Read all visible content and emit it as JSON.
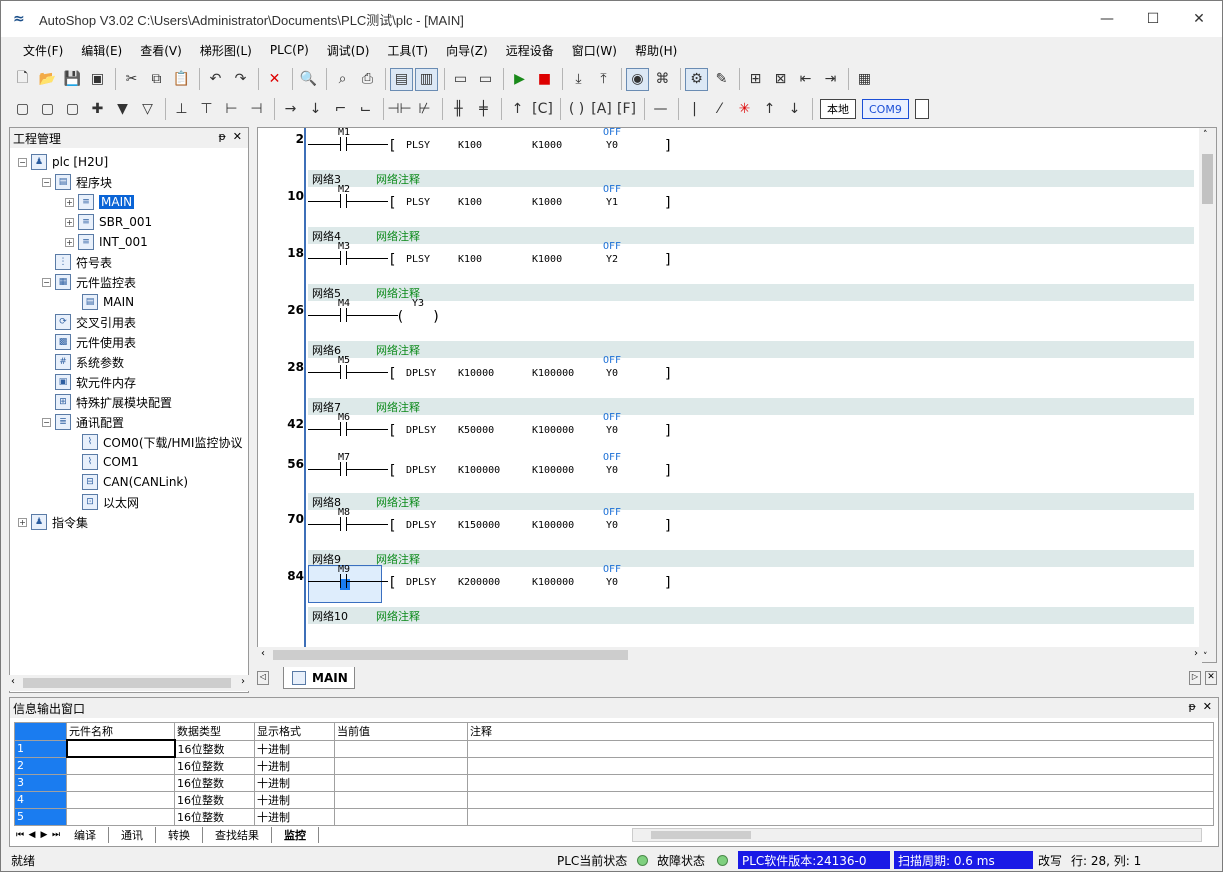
{
  "window": {
    "title": "AutoShop V3.02  C:\\Users\\Administrator\\Documents\\PLC测试\\plc - [MAIN]"
  },
  "menu": [
    "文件(F)",
    "编辑(E)",
    "查看(V)",
    "梯形图(L)",
    "PLC(P)",
    "调试(D)",
    "工具(T)",
    "向导(Z)",
    "远程设备",
    "窗口(W)",
    "帮助(H)"
  ],
  "toolbar2": {
    "local_label": "本地",
    "com_label": "COM9"
  },
  "project": {
    "title": "工程管理",
    "root": "plc [H2U]",
    "program_block": "程序块",
    "main": "MAIN",
    "sbr": "SBR_001",
    "int": "INT_001",
    "symbols": "符号表",
    "monitor_table": "元件监控表",
    "monitor_main": "MAIN",
    "cross_ref": "交叉引用表",
    "usage": "元件使用表",
    "sys_params": "系统参数",
    "soft_mem": "软元件内存",
    "ext_module": "特殊扩展模块配置",
    "comm": "通讯配置",
    "com0": "COM0(下载/HMI监控协议",
    "com1": "COM1",
    "can": "CAN(CANLink)",
    "ethernet": "以太网",
    "instructions": "指令集"
  },
  "ladder": {
    "comment_label": "网络注释",
    "nets": [
      {
        "step": "2",
        "contact": "M1",
        "instr": "PLSY",
        "a": "K100",
        "b": "K1000",
        "dst": "Y0",
        "state": "OFF"
      },
      {
        "net": "网络3",
        "step": "10",
        "contact": "M2",
        "instr": "PLSY",
        "a": "K100",
        "b": "K1000",
        "dst": "Y1",
        "state": "OFF"
      },
      {
        "net": "网络4",
        "step": "18",
        "contact": "M3",
        "instr": "PLSY",
        "a": "K100",
        "b": "K1000",
        "dst": "Y2",
        "state": "OFF"
      },
      {
        "net": "网络5",
        "step": "26",
        "contact": "M4",
        "coil": "Y3"
      },
      {
        "net": "网络6",
        "step": "28",
        "contact": "M5",
        "instr": "DPLSY",
        "a": "K10000",
        "b": "K100000",
        "dst": "Y0",
        "state": "OFF"
      },
      {
        "net": "网络7",
        "step": "42",
        "contact": "M6",
        "instr": "DPLSY",
        "a": "K50000",
        "b": "K100000",
        "dst": "Y0",
        "state": "OFF"
      },
      {
        "step": "56",
        "contact": "M7",
        "instr": "DPLSY",
        "a": "K100000",
        "b": "K100000",
        "dst": "Y0",
        "state": "OFF"
      },
      {
        "net": "网络8",
        "step": "70",
        "contact": "M8",
        "instr": "DPLSY",
        "a": "K150000",
        "b": "K100000",
        "dst": "Y0",
        "state": "OFF"
      },
      {
        "net": "网络9",
        "step": "84",
        "contact": "M9",
        "instr": "DPLSY",
        "a": "K200000",
        "b": "K100000",
        "dst": "Y0",
        "state": "OFF"
      },
      {
        "net": "网络10"
      }
    ],
    "tab": "MAIN"
  },
  "output": {
    "title": "信息输出窗口",
    "headers": [
      "元件名称",
      "数据类型",
      "显示格式",
      "当前值",
      "注释"
    ],
    "rows": [
      {
        "n": "1",
        "type": "16位整数",
        "fmt": "十进制"
      },
      {
        "n": "2",
        "type": "16位整数",
        "fmt": "十进制"
      },
      {
        "n": "3",
        "type": "16位整数",
        "fmt": "十进制"
      },
      {
        "n": "4",
        "type": "16位整数",
        "fmt": "十进制"
      },
      {
        "n": "5",
        "type": "16位整数",
        "fmt": "十进制"
      }
    ],
    "tabs": [
      "编译",
      "通讯",
      "转换",
      "查找结果",
      "监控"
    ]
  },
  "status": {
    "ready": "就绪",
    "plc_state": "PLC当前状态",
    "fault_state": "故障状态",
    "version": "PLC软件版本:24136-0",
    "scan": "扫描周期: 0.6 ms",
    "mode": "改写",
    "position": "行:  28, 列:   1"
  }
}
